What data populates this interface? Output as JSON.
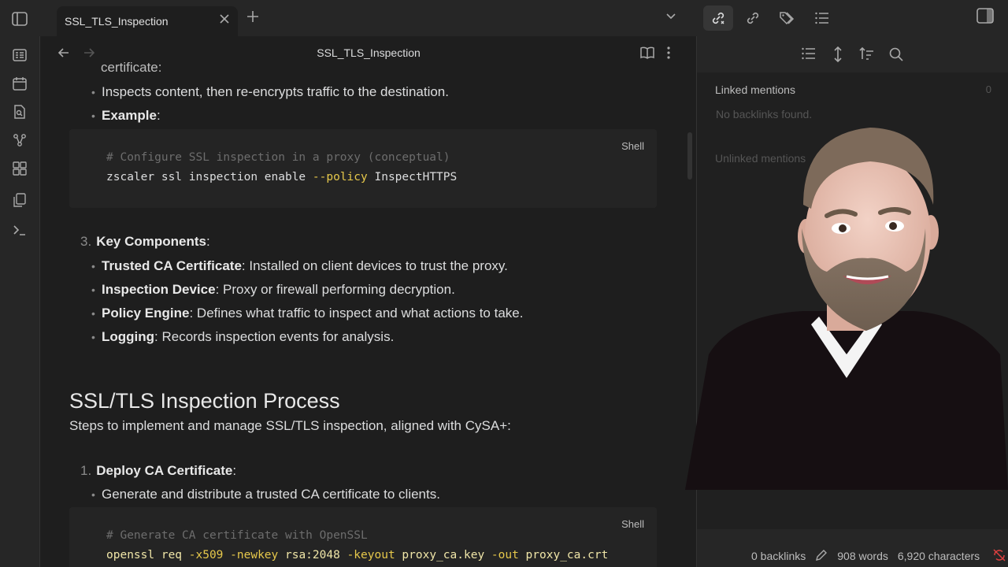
{
  "tab": {
    "title": "SSL_TLS_Inspection"
  },
  "view": {
    "title": "SSL_TLS_Inspection"
  },
  "content": {
    "cut_line": "certificate:",
    "l1": "Inspects content, then re-encrypts traffic to the destination.",
    "example_label": "Example",
    "code1": {
      "lang": "Shell",
      "comment": "# Configure SSL inspection in a proxy (conceptual)",
      "cmd": "zscaler ssl inspection enable ",
      "flag": "--policy",
      "arg": " InspectHTTPS"
    },
    "section3": {
      "num": "3.",
      "title": "Key Components"
    },
    "components": [
      {
        "term": "Trusted CA Certificate",
        "desc": ": Installed on client devices to trust the proxy."
      },
      {
        "term": "Inspection Device",
        "desc": ": Proxy or firewall performing decryption."
      },
      {
        "term": "Policy Engine",
        "desc": ": Defines what traffic to inspect and what actions to take."
      },
      {
        "term": "Logging",
        "desc": ": Records inspection events for analysis."
      }
    ],
    "h2": "SSL/TLS Inspection Process",
    "intro": "Steps to implement and manage SSL/TLS inspection, aligned with CySA+:",
    "step1": {
      "num": "1.",
      "title": "Deploy CA Certificate"
    },
    "step1_bullet": "Generate and distribute a trusted CA certificate to clients.",
    "code2": {
      "lang": "Shell",
      "comment": "# Generate CA certificate with OpenSSL",
      "t1": "openssl req ",
      "f1": "-x509",
      "t2": " ",
      "f2": "-newkey",
      "t3": " rsa:2048 ",
      "f3": "-keyout",
      "t4": " proxy_ca.key ",
      "f4": "-out",
      "t5": " proxy_ca.crt"
    }
  },
  "backlinks": {
    "linked_title": "Linked mentions",
    "linked_count": "0",
    "empty": "No backlinks found.",
    "unlinked_title": "Unlinked mentions"
  },
  "status": {
    "backlinks": "0 backlinks",
    "words": "908 words",
    "chars": "6,920 characters"
  },
  "colors": {
    "accent": "#e6c84b",
    "bg": "#1e1e1e",
    "panel": "#262626"
  }
}
